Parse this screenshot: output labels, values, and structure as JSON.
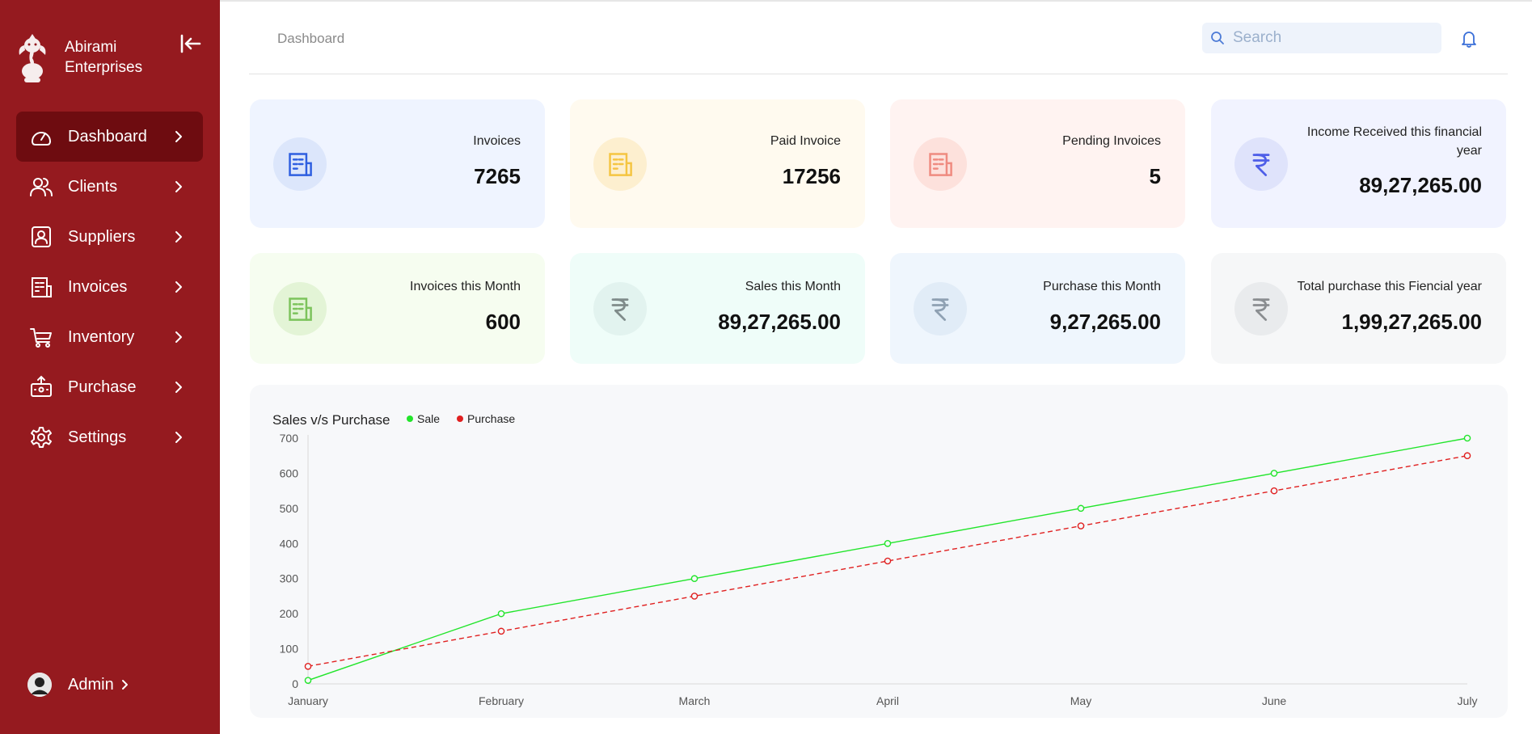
{
  "brand": {
    "name_line1": "Abirami",
    "name_line2": "Enterprises"
  },
  "sidebar": {
    "items": [
      {
        "label": "Dashboard",
        "icon": "gauge-icon",
        "active": true
      },
      {
        "label": "Clients",
        "icon": "users-icon"
      },
      {
        "label": "Suppliers",
        "icon": "contact-icon"
      },
      {
        "label": "Invoices",
        "icon": "invoice-icon"
      },
      {
        "label": "Inventory",
        "icon": "cart-icon"
      },
      {
        "label": "Purchase",
        "icon": "box-icon"
      },
      {
        "label": "Settings",
        "icon": "gear-icon"
      }
    ],
    "admin_label": "Admin"
  },
  "header": {
    "breadcrumb": "Dashboard",
    "search_placeholder": "Search"
  },
  "cards": [
    {
      "label": "Invoices",
      "value": "7265",
      "icon": "invoice-icon",
      "bg": "#eff4ff",
      "icon_bg": "#dce6fb",
      "icon_color": "#2f5fe0"
    },
    {
      "label": "Paid Invoice",
      "value": "17256",
      "icon": "invoice-icon",
      "bg": "#fffaef",
      "icon_bg": "#fdefcf",
      "icon_color": "#f5c542"
    },
    {
      "label": "Pending Invoices",
      "value": "5",
      "icon": "invoice-icon",
      "bg": "#fff3f1",
      "icon_bg": "#fde1dc",
      "icon_color": "#ef8b80"
    },
    {
      "label": "Income Received this financial year",
      "value": "89,27,265.00",
      "icon": "rupee-icon",
      "bg": "#f1f3ff",
      "icon_bg": "#dfe3fb",
      "icon_color": "#4e5ee8"
    },
    {
      "label": "Invoices this Month",
      "value": "600",
      "icon": "invoice-icon",
      "bg": "#f6fdf0",
      "icon_bg": "#e3f4d6",
      "icon_color": "#7cc35c"
    },
    {
      "label": "Sales this Month",
      "value": "89,27,265.00",
      "icon": "rupee-icon",
      "bg": "#effdf9",
      "icon_bg": "#e2f3ef",
      "icon_color": "#7f8b8a"
    },
    {
      "label": "Purchase this Month",
      "value": "9,27,265.00",
      "icon": "rupee-icon",
      "bg": "#eff6fd",
      "icon_bg": "#e1ecf7",
      "icon_color": "#8fa1b3"
    },
    {
      "label": "Total purchase this Fiencial year",
      "value": "1,99,27,265.00",
      "icon": "rupee-icon",
      "bg": "#f6f7f8",
      "icon_bg": "#e9ebed",
      "icon_color": "#8a8d90"
    }
  ],
  "chart_data": {
    "type": "line",
    "title": "Sales v/s Purchase",
    "categories": [
      "January",
      "February",
      "March",
      "April",
      "May",
      "June",
      "July"
    ],
    "series": [
      {
        "name": "Sale",
        "values": [
          10,
          200,
          300,
          400,
          500,
          600,
          700
        ],
        "color": "#22e52b",
        "dashed": false
      },
      {
        "name": "Purchase",
        "values": [
          50,
          150,
          250,
          350,
          450,
          550,
          650
        ],
        "color": "#e02020",
        "dashed": true
      }
    ],
    "yticks": [
      0,
      100,
      200,
      300,
      400,
      500,
      600,
      700
    ],
    "ylim": [
      0,
      700
    ],
    "legend": "top-left",
    "grid": false
  }
}
